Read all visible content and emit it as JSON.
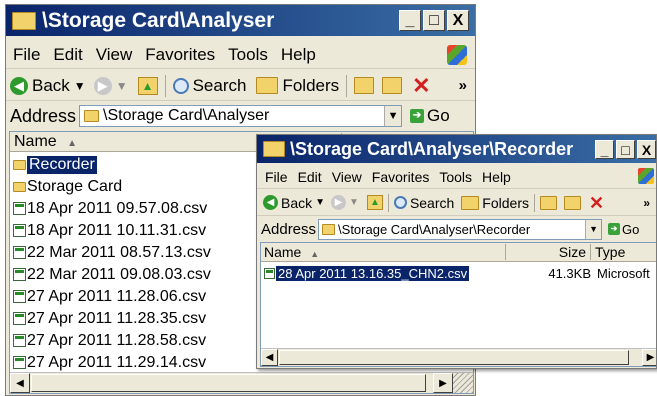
{
  "back_window": {
    "title": "\\Storage Card\\Analyser",
    "menu": [
      "File",
      "Edit",
      "View",
      "Favorites",
      "Tools",
      "Help"
    ],
    "toolbar": {
      "back": "Back",
      "search": "Search",
      "folders": "Folders",
      "more": "»"
    },
    "address": {
      "label": "Address",
      "value": "\\Storage Card\\Analyser",
      "go": "Go"
    },
    "columns": {
      "name": "Name"
    },
    "items": [
      {
        "name": "Recorder",
        "type": "folder",
        "selected": true
      },
      {
        "name": "Storage Card",
        "type": "folder",
        "selected": false
      },
      {
        "name": "18 Apr 2011 09.57.08.csv",
        "type": "csv",
        "selected": false
      },
      {
        "name": "18 Apr 2011 10.11.31.csv",
        "type": "csv",
        "selected": false
      },
      {
        "name": "22 Mar 2011 08.57.13.csv",
        "type": "csv",
        "selected": false
      },
      {
        "name": "22 Mar 2011 09.08.03.csv",
        "type": "csv",
        "selected": false
      },
      {
        "name": "27 Apr 2011 11.28.06.csv",
        "type": "csv",
        "selected": false
      },
      {
        "name": "27 Apr 2011 11.28.35.csv",
        "type": "csv",
        "selected": false
      },
      {
        "name": "27 Apr 2011 11.28.58.csv",
        "type": "csv",
        "selected": false
      },
      {
        "name": "27 Apr 2011 11.29.14.csv",
        "type": "csv",
        "selected": false
      }
    ]
  },
  "front_window": {
    "title": "\\Storage Card\\Analyser\\Recorder",
    "menu": [
      "File",
      "Edit",
      "View",
      "Favorites",
      "Tools",
      "Help"
    ],
    "toolbar": {
      "back": "Back",
      "search": "Search",
      "folders": "Folders",
      "more": "»"
    },
    "address": {
      "label": "Address",
      "value": "\\Storage Card\\Analyser\\Recorder",
      "go": "Go"
    },
    "columns": {
      "name": "Name",
      "size": "Size",
      "type": "Type"
    },
    "items": [
      {
        "name": "28 Apr 2011 13.16.35_CHN2.csv",
        "size": "41.3KB",
        "type": "Microsoft",
        "selected": true
      }
    ]
  },
  "icons": {
    "minimize": "_",
    "maximize": "□",
    "close": "X",
    "back_arrow": "back-arrow-icon",
    "forward_arrow": "forward-arrow-icon",
    "up": "up-folder-icon",
    "search": "search-icon",
    "folders": "folders-icon",
    "move_to": "move-to-icon",
    "copy_to": "copy-to-icon",
    "delete": "delete-icon"
  },
  "colors": {
    "title_bar_start": "#0a246a",
    "title_bar_end": "#3a6ea5",
    "selection": "#0a246a",
    "window_face": "#ece9d8"
  }
}
